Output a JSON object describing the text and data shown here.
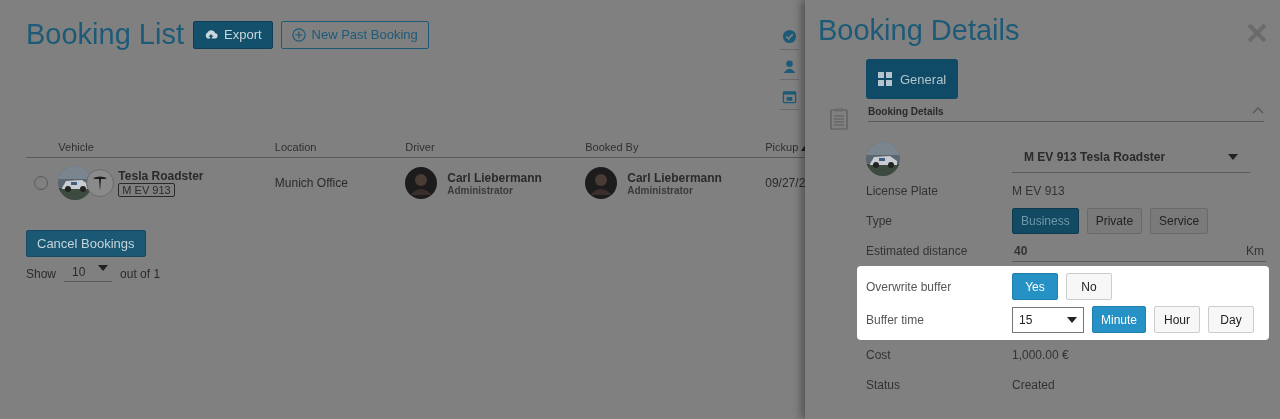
{
  "page": {
    "title": "Booking List",
    "export_button": "Export",
    "new_button": "New Past Booking"
  },
  "table": {
    "columns": [
      "Vehicle",
      "Location",
      "Driver",
      "Booked By",
      "Pickup"
    ],
    "rows": [
      {
        "selected": false,
        "vehicle": "Tesla Roadster",
        "plate": "M EV 913",
        "location": "Munich Office",
        "driver": {
          "name": "Carl Liebermann",
          "role": "Administrator"
        },
        "booked_by": {
          "name": "Carl Liebermann",
          "role": "Administrator"
        },
        "pickup": "09/27/2"
      }
    ]
  },
  "cancel_button": "Cancel Bookings",
  "pagination": {
    "show_label": "Show",
    "page_size": "10",
    "out_of": "out of 1"
  },
  "drawer": {
    "title": "Booking Details",
    "tabs": [
      {
        "label": "General",
        "selected": true
      }
    ],
    "section": {
      "title": "Booking Details",
      "expanded": true
    },
    "vehicle_select": "M EV 913 Tesla Roadster",
    "fields": [
      {
        "kind": "text",
        "label": "License Plate",
        "value": "M EV 913"
      },
      {
        "kind": "choice",
        "label": "Type",
        "options": [
          {
            "label": "Business",
            "selected": true
          },
          {
            "label": "Private",
            "selected": false
          },
          {
            "label": "Service",
            "selected": false
          }
        ]
      },
      {
        "kind": "input",
        "label": "Estimated distance",
        "value": "40",
        "unit": "Km"
      },
      {
        "kind": "choice",
        "highlight": true,
        "label": "Overwrite buffer",
        "options": [
          {
            "label": "Yes",
            "selected": true
          },
          {
            "label": "No",
            "selected": false
          }
        ]
      },
      {
        "kind": "buffer",
        "highlight": true,
        "label": "Buffer time",
        "value": "15",
        "options": [
          {
            "label": "Minute",
            "selected": true
          },
          {
            "label": "Hour",
            "selected": false
          },
          {
            "label": "Day",
            "selected": false
          }
        ]
      },
      {
        "kind": "text",
        "label": "Cost",
        "value": "1,000.00 €"
      },
      {
        "kind": "text",
        "label": "Status",
        "value": "Created"
      }
    ]
  }
}
